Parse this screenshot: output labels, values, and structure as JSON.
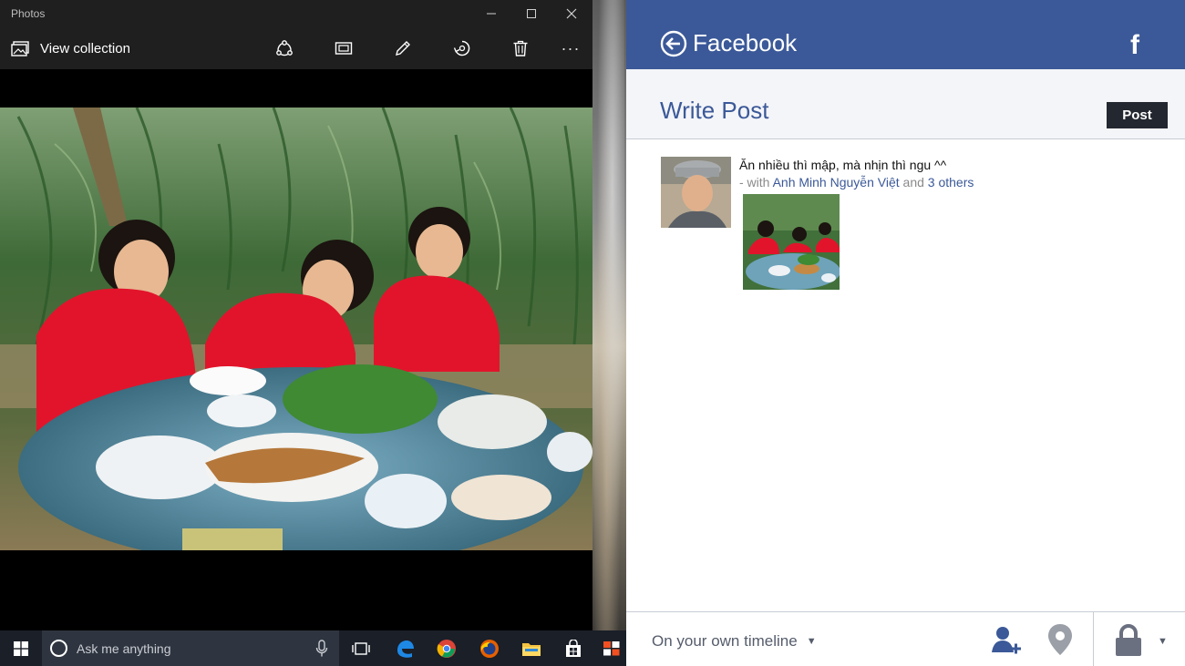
{
  "photos": {
    "window_title": "Photos",
    "view_collection_label": "View collection",
    "toolbar_icons": [
      "share-icon",
      "slideshow-icon",
      "edit-icon",
      "rotate-icon",
      "delete-icon",
      "more-icon"
    ],
    "more_label": "···"
  },
  "facebook": {
    "app_title": "Facebook",
    "logo_letter": "f",
    "page_heading": "Write Post",
    "post_button": "Post",
    "post_message": "Ăn nhiều thì mập, mà nhịn thì ngu ^^",
    "with_prefix": "- with",
    "tagged_person": "Anh Minh Nguyễn Việt",
    "with_and": "and",
    "others_link": "3 others",
    "audience": "On your own timeline",
    "colors": {
      "brand": "#3b5998",
      "subhead_bg": "#f4f5f9",
      "post_button_bg": "#23272f"
    }
  },
  "taskbar": {
    "search_placeholder": "Ask me anything",
    "pinned_icons": [
      "task-view-icon",
      "edge-icon",
      "chrome-icon",
      "firefox-icon",
      "file-explorer-icon",
      "store-icon",
      "windows-app-icon"
    ]
  }
}
